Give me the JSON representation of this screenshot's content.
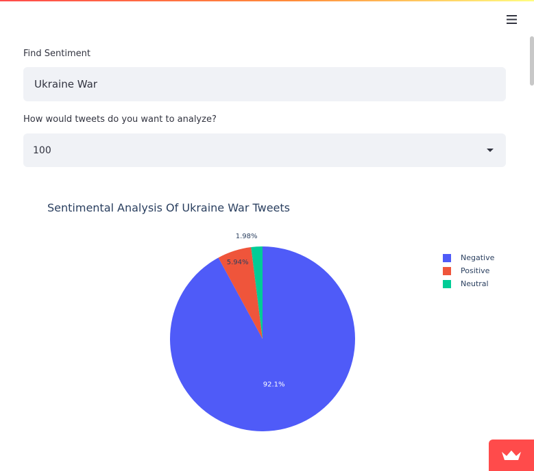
{
  "app": {
    "menu_icon": "hamburger-menu-icon",
    "accent_color": "#ff4b4b",
    "badge_icon": "streamlit-crown-icon"
  },
  "form": {
    "search_label": "Find Sentiment",
    "search_value": "Ukraine War",
    "count_label": "How would tweets do you want to analyze?",
    "count_value": "100",
    "count_icon": "caret-down-icon"
  },
  "chart_data": {
    "type": "pie",
    "title": "Sentimental Analysis Of Ukraine War Tweets",
    "labels": [
      "Negative",
      "Positive",
      "Neutral"
    ],
    "values": [
      92.1,
      5.94,
      1.98
    ],
    "value_labels": [
      "92.1%",
      "5.94%",
      "1.98%"
    ],
    "colors": [
      "#4f5bf8",
      "#ef553b",
      "#00cc96"
    ],
    "legend_position": "top-right"
  }
}
